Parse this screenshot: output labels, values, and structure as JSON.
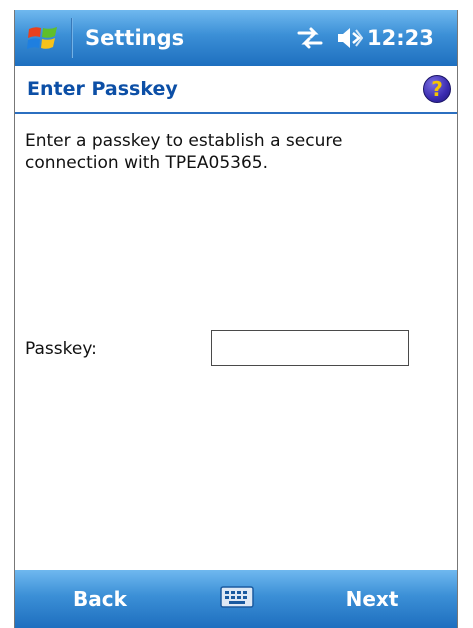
{
  "titlebar": {
    "app_title": "Settings",
    "time": "12:23",
    "icons": {
      "start": "windows-flag-icon",
      "connectivity": "connectivity-icon",
      "volume": "speaker-icon"
    }
  },
  "page": {
    "title": "Enter Passkey",
    "help_icon": "help-icon",
    "help_glyph": "?"
  },
  "content": {
    "instruction": "Enter a passkey to establish a secure connection with TPEA05365.",
    "passkey_label": "Passkey:",
    "passkey_value": "",
    "passkey_placeholder": ""
  },
  "softkeys": {
    "left_label": "Back",
    "right_label": "Next",
    "sip_icon": "keyboard-icon"
  },
  "colors": {
    "bar_top": "#6fb8ef",
    "bar_bottom": "#1e6fbf",
    "page_title": "#0c4fa6",
    "header_rule": "#2b6fc0"
  }
}
